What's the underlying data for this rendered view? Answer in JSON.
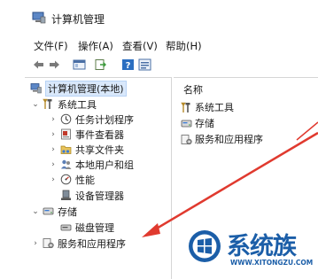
{
  "window": {
    "title": "计算机管理"
  },
  "menu": [
    {
      "label": "文件(F)"
    },
    {
      "label": "操作(A)"
    },
    {
      "label": "查看(V)"
    },
    {
      "label": "帮助(H)"
    }
  ],
  "toolbar": {
    "icons": [
      "back-arrow-icon",
      "forward-arrow-icon",
      "show-hide-tree-icon",
      "export-list-icon",
      "help-icon",
      "properties-icon"
    ]
  },
  "tree": {
    "root": "计算机管理(本地)",
    "system_tools": "系统工具",
    "task_scheduler": "任务计划程序",
    "event_viewer": "事件查看器",
    "shared_folders": "共享文件夹",
    "local_users": "本地用户和组",
    "performance": "性能",
    "device_manager": "设备管理器",
    "storage": "存储",
    "disk_management": "磁盘管理",
    "services_apps": "服务和应用程序"
  },
  "right": {
    "column_header": "名称",
    "items": [
      "系统工具",
      "存储",
      "服务和应用程序"
    ]
  },
  "watermark": {
    "text": "系统族",
    "url": "WWW.XITONGZU.COM"
  },
  "colors": {
    "accent_arrow": "#e03a2f",
    "watermark_blue": "#1b5ea8",
    "selection": "#d9e8fb"
  }
}
